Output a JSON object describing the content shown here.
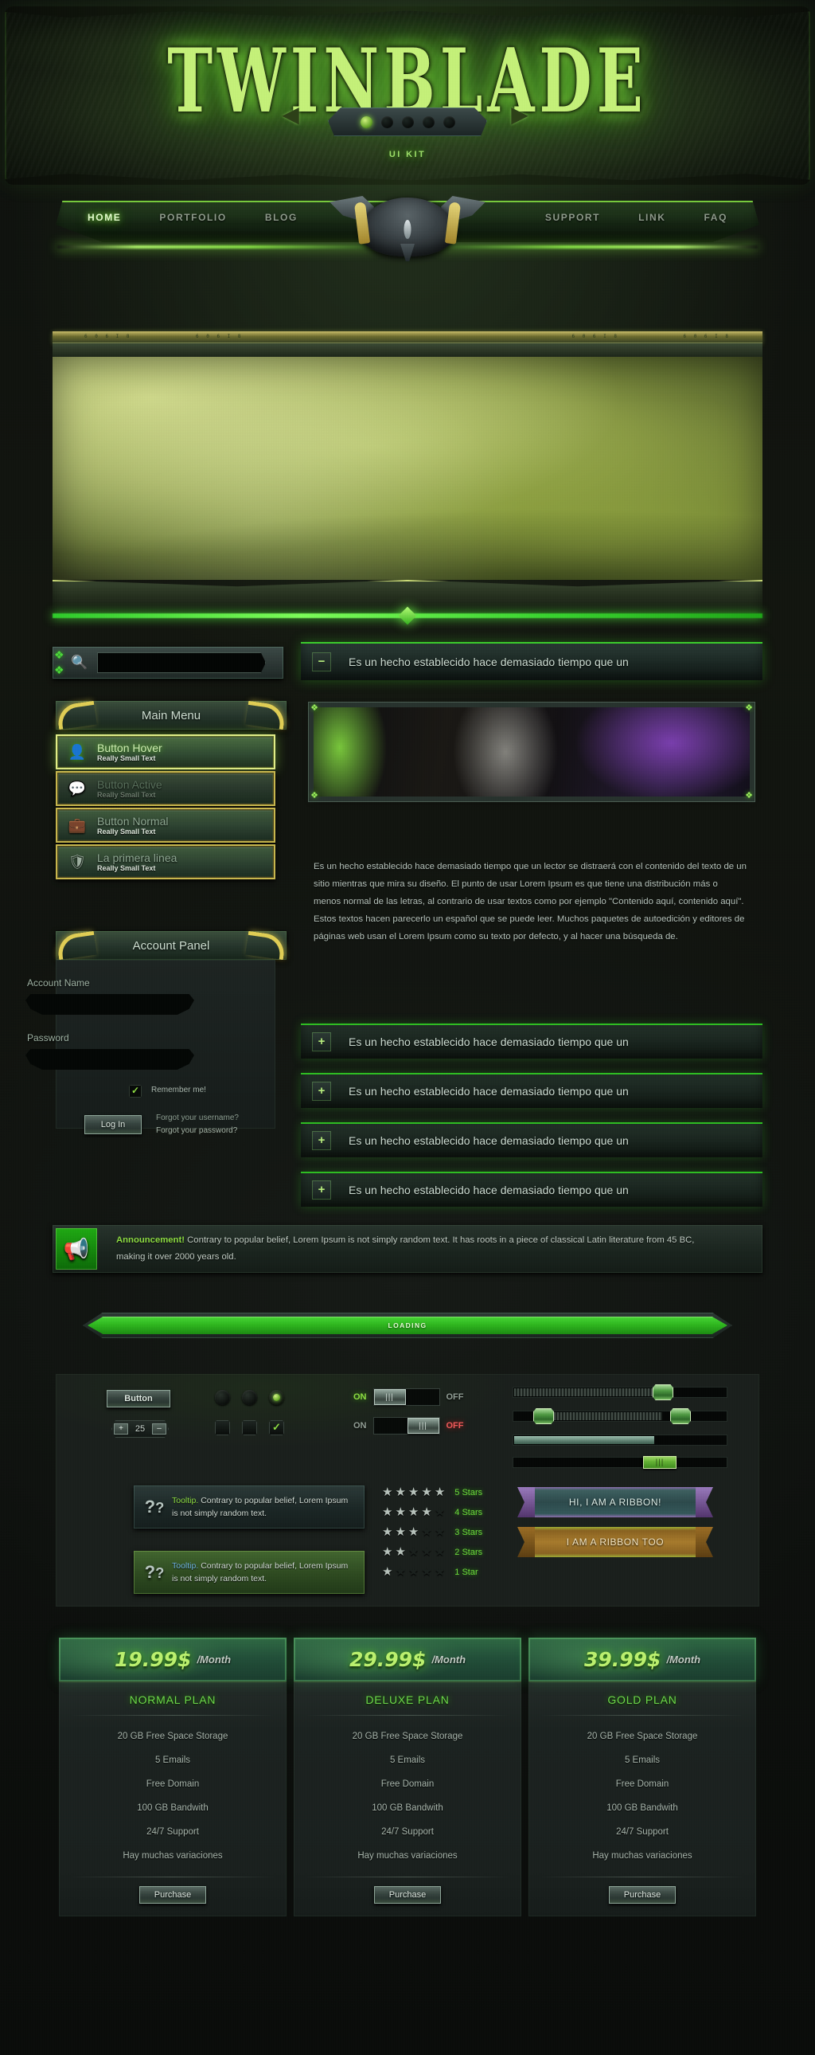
{
  "site": {
    "logo": "TWINBLADE",
    "subtitle": "UI KIT"
  },
  "nav": {
    "left": [
      {
        "label": "HOME",
        "active": true
      },
      {
        "label": "PORTFOLIO",
        "active": false
      },
      {
        "label": "BLOG",
        "active": false
      }
    ],
    "right": [
      {
        "label": "SUPPORT",
        "active": false
      },
      {
        "label": "LINK",
        "active": false
      },
      {
        "label": "FAQ",
        "active": false
      }
    ],
    "crest_icon": "dragon-crest-icon"
  },
  "slider": {
    "prev_icon": "chevron-left-icon",
    "next_icon": "chevron-right-icon",
    "dots_total": 5,
    "dot_active_index": 0,
    "rune_text": "6 0 6 I 8"
  },
  "search": {
    "icon": "search-icon",
    "value": "",
    "placeholder": ""
  },
  "accordion": {
    "open_item": {
      "icon": "minus-icon",
      "title": "Es un hecho establecido hace demasiado tiempo que un"
    },
    "closed_items": [
      {
        "icon": "plus-icon",
        "title": "Es un hecho establecido hace demasiado tiempo que un"
      },
      {
        "icon": "plus-icon",
        "title": "Es un hecho establecido hace demasiado tiempo que un"
      },
      {
        "icon": "plus-icon",
        "title": "Es un hecho establecido hace demasiado tiempo que un"
      },
      {
        "icon": "plus-icon",
        "title": "Es un hecho establecido hace demasiado tiempo que un"
      }
    ],
    "body_text": "Es un hecho establecido hace demasiado tiempo que un lector se distraerá con el contenido del texto de un sitio mientras que mira su diseño. El punto de usar Lorem Ipsum es que tiene una distribución más o menos normal de las letras, al contrario de usar textos como por ejemplo \"Contenido aquí, contenido aquí\". Estos textos hacen parecerlo un español que se puede leer. Muchos paquetes de autoedición y editores de páginas web usan el Lorem Ipsum como su texto por defecto, y al hacer una búsqueda de."
  },
  "main_menu": {
    "title": "Main Menu",
    "items": [
      {
        "label": "Button Hover",
        "sub": "Really Small Text",
        "state": "hover",
        "icon": "user-icon"
      },
      {
        "label": "Button Active",
        "sub": "Really Small Text",
        "state": "active",
        "icon": "chat-bubble-icon"
      },
      {
        "label": "Button Normal",
        "sub": "Really Small Text",
        "state": "normal",
        "icon": "bag-icon"
      },
      {
        "label": "La primera linea",
        "sub": "Really Small Text",
        "state": "normal",
        "icon": "shield-icon"
      }
    ]
  },
  "account_panel": {
    "title": "Account Panel",
    "name_label": "Account Name",
    "name_value": "",
    "password_label": "Password",
    "password_value": "",
    "remember_label": "Remember me!",
    "remember_checked": true,
    "login_label": "Log In",
    "forgot_username": "Forgot your username?",
    "forgot_password": "Forgot your password?"
  },
  "announcement": {
    "icon": "megaphone-icon",
    "keyword": "Announcement!",
    "text": " Contrary to popular belief, Lorem Ipsum is not simply random text. It has roots in a piece of classical Latin literature from 45 BC, making it over 2000 years old."
  },
  "loading": {
    "label": "LOADING",
    "percent": 100
  },
  "widgets": {
    "button_label": "Button",
    "stepper": {
      "plus": "+",
      "minus": "–",
      "value": "25"
    },
    "radios": [
      {
        "selected": false
      },
      {
        "selected": false
      },
      {
        "selected": true
      }
    ],
    "checkboxes": [
      {
        "checked": false
      },
      {
        "checked": false
      },
      {
        "checked": true
      }
    ],
    "toggles": [
      {
        "left_label": "ON",
        "right_label": "OFF",
        "state": "on",
        "knob_glyph": "|||"
      },
      {
        "left_label": "ON",
        "right_label": "OFF",
        "state": "off",
        "knob_glyph": "|||"
      }
    ],
    "sliders": [
      {
        "type": "single-hatch",
        "value": 72
      },
      {
        "type": "range-hatch",
        "low": 14,
        "high": 84
      },
      {
        "type": "progress",
        "value": 72
      },
      {
        "type": "wide-knob",
        "value": 70,
        "knob_glyph": "|||"
      }
    ],
    "tooltips": [
      {
        "icon": "question-marks-icon",
        "keyword": "Tooltip.",
        "text": " Contrary to popular belief, Lorem Ipsum is not simply random text.",
        "variant": "dark"
      },
      {
        "icon": "question-marks-icon",
        "keyword": "Tooltip.",
        "text": " Contrary to popular belief, Lorem Ipsum is not simply random text.",
        "variant": "green"
      }
    ],
    "ratings": [
      {
        "filled": 5,
        "label": "5 Stars"
      },
      {
        "filled": 4,
        "label": "4 Stars"
      },
      {
        "filled": 3,
        "label": "3 Stars"
      },
      {
        "filled": 2,
        "label": "2 Stars"
      },
      {
        "filled": 1,
        "label": "1 Star"
      }
    ],
    "ribbons": [
      {
        "label": "HI, I AM A RIBBON!",
        "variant": "purple"
      },
      {
        "label": "I AM A RIBBON TOO",
        "variant": "gold"
      }
    ]
  },
  "pricing": {
    "period": "/Month",
    "buy_label": "Purchase",
    "plans": [
      {
        "price": "19.99$",
        "name": "NORMAL PLAN",
        "features": [
          "20 GB Free Space Storage",
          "5 Emails",
          "Free Domain",
          "100 GB Bandwith",
          "24/7 Support",
          "Hay muchas variaciones"
        ]
      },
      {
        "price": "29.99$",
        "name": "DELUXE PLAN",
        "features": [
          "20 GB Free Space Storage",
          "5 Emails",
          "Free Domain",
          "100 GB Bandwith",
          "24/7 Support",
          "Hay muchas variaciones"
        ]
      },
      {
        "price": "39.99$",
        "name": "GOLD PLAN",
        "features": [
          "20 GB Free Space Storage",
          "5 Emails",
          "Free Domain",
          "100 GB Bandwith",
          "24/7 Support",
          "Hay muchas variaciones"
        ]
      }
    ]
  },
  "colors": {
    "accent_green": "#8ede43",
    "bright_green": "#b6ff6e",
    "gold": "#e2cf55",
    "danger_red": "#ef5a5a",
    "panel_dark": "#1a1f1c"
  }
}
